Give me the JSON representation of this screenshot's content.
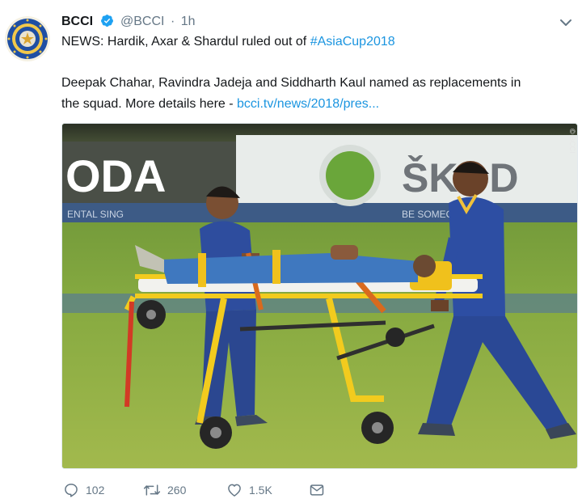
{
  "tweet": {
    "author_name": "BCCI",
    "handle": "@BCCI",
    "separator": "·",
    "time": "1h",
    "line1_text": "NEWS: Hardik, Axar & Shardul ruled out of ",
    "hashtag": "#AsiaCup2018",
    "line2_text": "Deepak Chahar, Ravindra Jadeja and Siddharth Kaul named as replacements in",
    "line3_text": "the squad. More details here - ",
    "link_text": "bcci.tv/news/2018/pres...",
    "media": {
      "photo_credit": "© BCCI",
      "banner_left": "ODA",
      "banner_right": "ŠKOD",
      "banner_strip_left": "ENTAL SING",
      "banner_strip_right": "BE SOMEONE"
    },
    "actions": {
      "reply_count": "102",
      "retweet_count": "260",
      "like_count": "1.5K"
    }
  },
  "colors": {
    "accent": "#1b95e0",
    "muted": "#657786",
    "text": "#14171a",
    "verified": "#1da1f2"
  },
  "icons": [
    "bcci-logo",
    "verified-badge-icon",
    "chevron-down-icon",
    "reply-icon",
    "retweet-icon",
    "like-icon",
    "direct-message-icon"
  ]
}
